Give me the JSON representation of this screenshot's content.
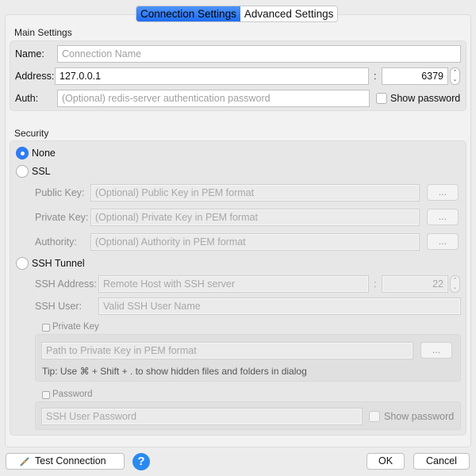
{
  "tabs": [
    {
      "label": "Connection Settings",
      "active": true
    },
    {
      "label": "Advanced Settings",
      "active": false
    }
  ],
  "main": {
    "title": "Main Settings",
    "name_label": "Name:",
    "name_placeholder": "Connection Name",
    "address_label": "Address:",
    "address_value": "127.0.0.1",
    "colon": ":",
    "port_value": "6379",
    "auth_label": "Auth:",
    "auth_placeholder": "(Optional) redis-server authentication password",
    "show_password_label": "Show password"
  },
  "security": {
    "title": "Security",
    "none_label": "None",
    "ssl_label": "SSL",
    "selected": "None",
    "ssl": {
      "public_key_label": "Public Key:",
      "public_key_placeholder": "(Optional) Public Key in PEM format",
      "private_key_label": "Private Key:",
      "private_key_placeholder": "(Optional) Private Key in PEM format",
      "authority_label": "Authority:",
      "authority_placeholder": "(Optional) Authority in PEM format",
      "browse_label": "..."
    },
    "ssh_label": "SSH Tunnel",
    "ssh": {
      "address_label": "SSH Address:",
      "address_placeholder": "Remote Host with SSH server",
      "colon": ":",
      "port_value": "22",
      "user_label": "SSH User:",
      "user_placeholder": "Valid SSH User Name",
      "private_key_check_label": "Private Key",
      "private_key_path_placeholder": "Path to Private Key in PEM format",
      "browse_label": "...",
      "tip": "Tip: Use ⌘ + Shift + . to show hidden files and folders in dialog",
      "password_check_label": "Password",
      "password_placeholder": "SSH User Password",
      "show_password_label": "Show password"
    }
  },
  "footer": {
    "test_connection_label": "Test Connection",
    "help_glyph": "?",
    "ok_label": "OK",
    "cancel_label": "Cancel"
  },
  "colors": {
    "accent": "#2e7cf6",
    "tab_active": "#1f6ef3",
    "help": "#2a8af0"
  }
}
